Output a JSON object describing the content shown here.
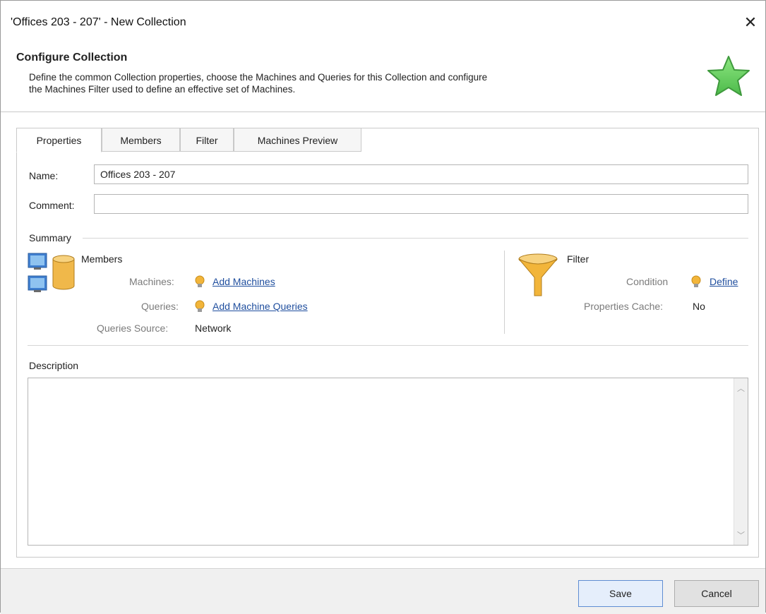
{
  "window": {
    "title": "'Offices 203 - 207' - New Collection",
    "close_icon": "close-icon"
  },
  "header": {
    "title": "Configure Collection",
    "description_line1": "Define the common Collection properties, choose the Machines and Queries for this Collection and configure",
    "description_line2": "the Machines Filter used to define an effective set of Machines.",
    "icon": "star-icon"
  },
  "tabs": [
    {
      "label": "Properties",
      "active": true
    },
    {
      "label": "Members",
      "active": false
    },
    {
      "label": "Filter",
      "active": false
    },
    {
      "label": "Machines Preview",
      "active": false
    }
  ],
  "form": {
    "name_label": "Name:",
    "name_value": "Offices 203 - 207",
    "comment_label": "Comment:",
    "comment_value": ""
  },
  "summary": {
    "label": "Summary",
    "members": {
      "title": "Members",
      "machines_label": "Machines:",
      "machines_link": "Add Machines",
      "queries_label": "Queries:",
      "queries_link": "Add Machine Queries",
      "source_label": "Queries Source:",
      "source_value": "Network"
    },
    "filter": {
      "title": "Filter",
      "condition_label": "Condition",
      "condition_link": "Define",
      "cache_label": "Properties Cache:",
      "cache_value": "No"
    }
  },
  "description": {
    "label": "Description",
    "value": ""
  },
  "footer": {
    "save_label": "Save",
    "cancel_label": "Cancel"
  },
  "colors": {
    "accent_link": "#1f4e9e",
    "star_green": "#6fd06a",
    "funnel_orange": "#f2b53a"
  }
}
